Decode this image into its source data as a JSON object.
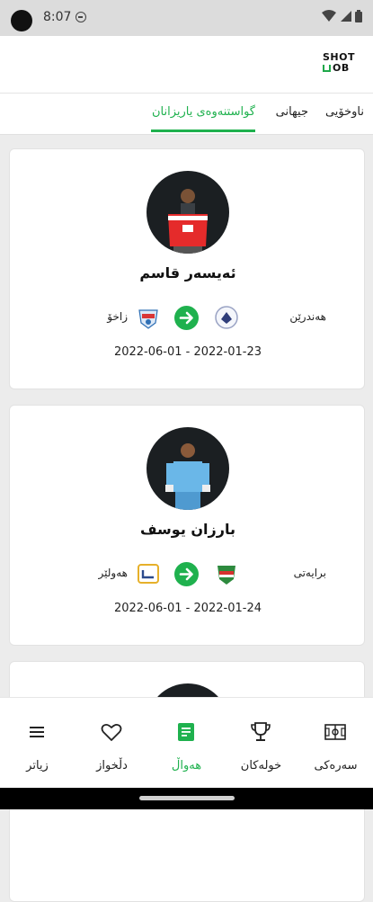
{
  "status_bar": {
    "time": "8:07"
  },
  "app": {
    "logo_line1": "SHOT",
    "logo_line2": "OB"
  },
  "tabs": [
    {
      "label": "ناوخۆیی",
      "active": false
    },
    {
      "label": "جیهانی",
      "active": false
    },
    {
      "label": "گواستنەوەی یاریزانان",
      "active": true
    }
  ],
  "transfers": [
    {
      "player": "ئەیسەر قاسم",
      "from_team": "هەندرێن",
      "to_team": "زاخۆ",
      "dates": "2022-06-01 - 2022-01-23"
    },
    {
      "player": "بارزان یوسف",
      "from_team": "برایەتی",
      "to_team": "هەولێر",
      "dates": "2022-06-01 - 2022-01-24"
    }
  ],
  "bottom_nav": [
    {
      "label": "سەرەکی",
      "icon": "pitch-icon",
      "active": false
    },
    {
      "label": "خولەکان",
      "icon": "trophy-icon",
      "active": false
    },
    {
      "label": "هەواڵ",
      "icon": "news-icon",
      "active": true
    },
    {
      "label": "دڵخواز",
      "icon": "heart-icon",
      "active": false
    },
    {
      "label": "زیاتر",
      "icon": "menu-icon",
      "active": false
    }
  ],
  "colors": {
    "accent": "#1fb14e",
    "background": "#ececec"
  }
}
